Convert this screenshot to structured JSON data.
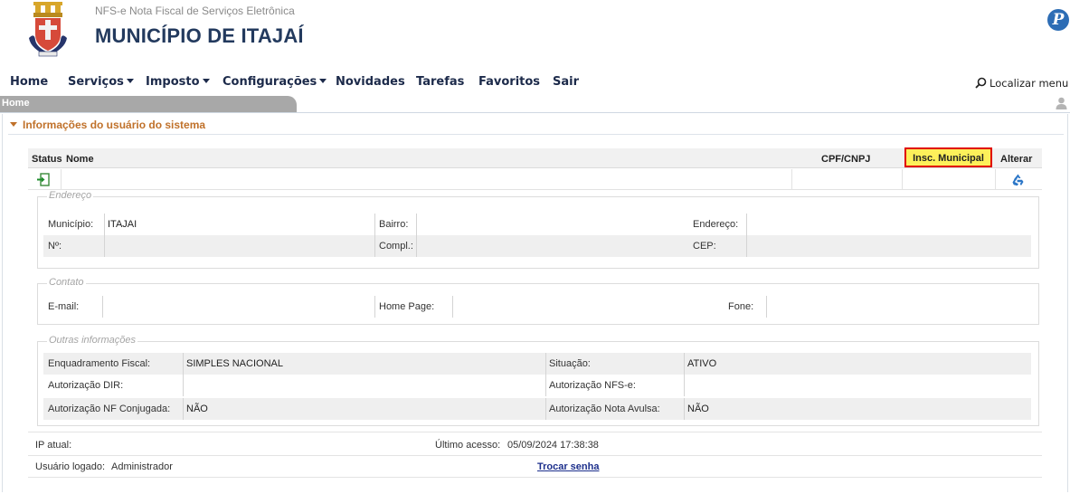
{
  "header": {
    "subtitle": "NFS-e Nota Fiscal de Serviços Eletrônica",
    "title": "MUNICÍPIO DE ITAJAÍ",
    "brand_glyph": "P"
  },
  "menu": {
    "items": [
      "Home",
      "Serviços",
      "Imposto",
      "Configurações",
      "Novidades",
      "Tarefas",
      "Favoritos",
      "Sair"
    ],
    "locate_label": "Localizar menu"
  },
  "breadcrumb": {
    "current": "Home"
  },
  "section": {
    "title": "Informações do usuário do sistema"
  },
  "table": {
    "headers": {
      "status": "Status",
      "name": "Nome",
      "cpf_cnpj": "CPF/CNPJ",
      "insc_municipal": "Insc. Municipal",
      "alterar": "Alterar"
    },
    "row": {
      "status_icon": "login-icon",
      "alterar_icon": "recycle-icon"
    }
  },
  "endereco": {
    "legend": "Endereço",
    "municipio_label": "Município:",
    "municipio_value": "ITAJAI",
    "bairro_label": "Bairro:",
    "endereco_label": "Endereço:",
    "numero_label": "Nº:",
    "compl_label": "Compl.:",
    "cep_label": "CEP:"
  },
  "contato": {
    "legend": "Contato",
    "email_label": "E-mail:",
    "homepage_label": "Home Page:",
    "fone_label": "Fone:"
  },
  "outras": {
    "legend": "Outras informações",
    "enquadramento_label": "Enquadramento Fiscal:",
    "enquadramento_value": "SIMPLES NACIONAL",
    "situacao_label": "Situação:",
    "situacao_value": "ATIVO",
    "aut_dir_label": "Autorização DIR:",
    "aut_nfse_label": "Autorização NFS-e:",
    "aut_nf_conj_label": "Autorização NF Conjugada:",
    "aut_nf_conj_value": "NÃO",
    "aut_nota_avulsa_label": "Autorização Nota Avulsa:",
    "aut_nota_avulsa_value": "NÃO"
  },
  "footer": {
    "ip_label": "IP atual:",
    "ultimo_acesso_label": "Último acesso:",
    "ultimo_acesso_value": "05/09/2024 17:38:38",
    "usuario_label": "Usuário logado:",
    "usuario_value": "Administrador",
    "trocar_senha": "Trocar senha"
  },
  "colors": {
    "title": "#233a5e",
    "menu": "#1c2a4a",
    "section_title": "#c0712a",
    "highlight_fill": "#fdf05a",
    "highlight_border": "#e00000",
    "link": "#1c2f8c"
  }
}
